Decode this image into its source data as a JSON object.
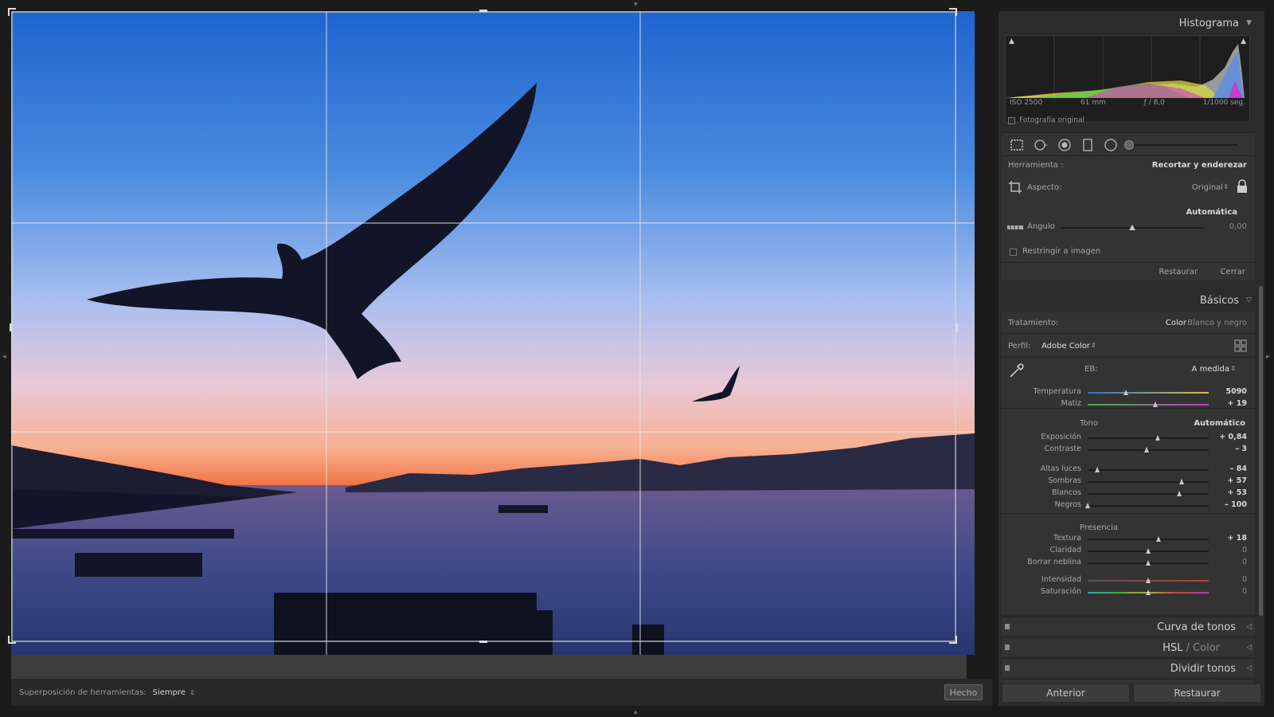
{
  "colors": {
    "accent_ui": "#b8b8b8",
    "sky_top": "#2a6dd0",
    "sunset": "#f06a3a"
  },
  "crop": {
    "overlay_label": "Superposición de herramientas:",
    "overlay_value": "Siempre",
    "done_label": "Hecho"
  },
  "histogram": {
    "title": "Histograma",
    "iso": "ISO 2500",
    "focal": "61 mm",
    "aperture": "ƒ / 8,0",
    "shutter": "1/1000 seg.",
    "original_label": "Fotografía original"
  },
  "crop_tool": {
    "tool_label": "Herramienta :",
    "tool_name": "Recortar y enderezar",
    "aspect_label": "Aspecto:",
    "aspect_value": "Original",
    "auto_label": "Automática",
    "angle_label": "Ángulo",
    "angle_value": "0,00",
    "constrain_label": "Restringir a imagen",
    "reset_label": "Restaurar",
    "close_label": "Cerrar"
  },
  "basic": {
    "title": "Básicos",
    "treatment_label": "Tratamiento:",
    "treatment_color": "Color",
    "treatment_bw": "Blanco y negro",
    "profile_label": "Perfil:",
    "profile_value": "Adobe Color",
    "wb_label": "EB:",
    "wb_value": "A medida",
    "tone_label": "Tono",
    "auto_label": "Automático",
    "presence_label": "Presencia",
    "sliders": [
      {
        "label": "Temperatura",
        "value": "5090",
        "pos": 0.32
      },
      {
        "label": "Matiz",
        "value": "+ 19",
        "pos": 0.56
      },
      {
        "label": "Exposición",
        "value": "+ 0,84",
        "pos": 0.58
      },
      {
        "label": "Contraste",
        "value": "– 3",
        "pos": 0.49
      },
      {
        "label": "Altas luces",
        "value": "– 84",
        "pos": 0.08
      },
      {
        "label": "Sombras",
        "value": "+ 57",
        "pos": 0.78
      },
      {
        "label": "Blancos",
        "value": "+ 53",
        "pos": 0.76
      },
      {
        "label": "Negros",
        "value": "– 100",
        "pos": 0.0
      },
      {
        "label": "Textura",
        "value": "+ 18",
        "pos": 0.59
      },
      {
        "label": "Claridad",
        "value": "0",
        "pos": 0.5
      },
      {
        "label": "Borrar neblina",
        "value": "0",
        "pos": 0.5
      },
      {
        "label": "Intensidad",
        "value": "0",
        "pos": 0.5
      },
      {
        "label": "Saturación",
        "value": "0",
        "pos": 0.5
      }
    ]
  },
  "panels": {
    "tone_curve": "Curva de tonos",
    "hsl": "HSL",
    "hsl_sep": " / ",
    "hsl_color": "Color",
    "split": "Dividir tonos"
  },
  "nav": {
    "prev": "Anterior",
    "reset": "Restaurar"
  }
}
